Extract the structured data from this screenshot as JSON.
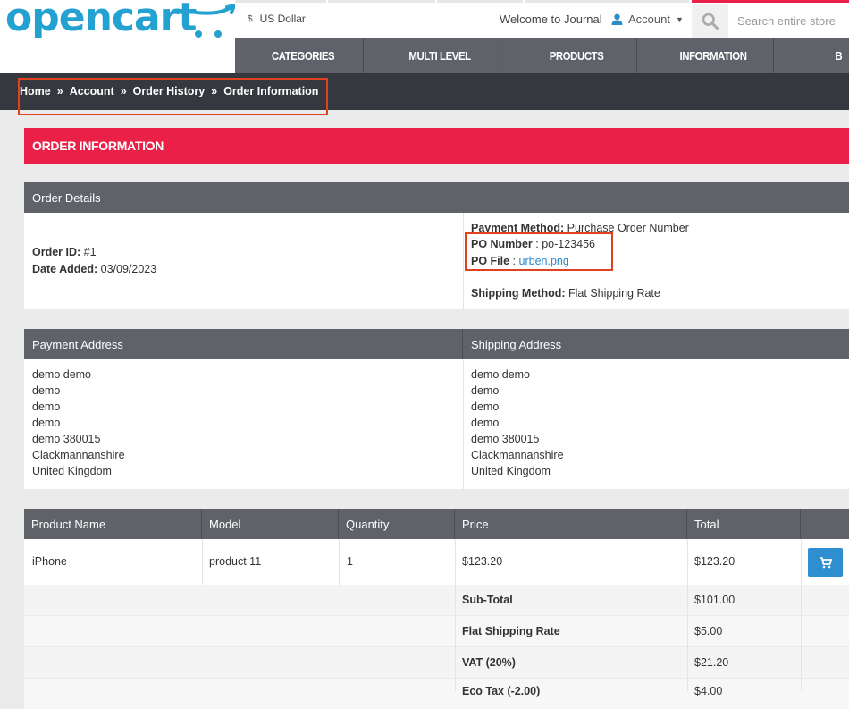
{
  "header": {
    "logo_text": "opencart",
    "currency": {
      "symbol": "$",
      "label": "US Dollar"
    },
    "welcome": "Welcome to Journal",
    "account_label": "Account",
    "search_placeholder": "Search entire store",
    "menu": [
      "CATEGORIES",
      "MULTI LEVEL",
      "PRODUCTS",
      "INFORMATION",
      "B"
    ]
  },
  "breadcrumb": [
    "Home",
    "Account",
    "Order History",
    "Order Information"
  ],
  "breadcrumb_separator": "»",
  "page_title": "ORDER INFORMATION",
  "order_details": {
    "heading": "Order Details",
    "order_id_label": "Order ID:",
    "order_id": "#1",
    "date_added_label": "Date Added:",
    "date_added": "03/09/2023",
    "payment_method_label": "Payment Method:",
    "payment_method": "Purchase Order Number",
    "po_number_label": "PO Number",
    "po_number": ": po-123456",
    "po_file_label": "PO File",
    "po_file_sep": " : ",
    "po_file": "urben.png",
    "shipping_method_label": "Shipping Method:",
    "shipping_method": "Flat Shipping Rate"
  },
  "addresses": {
    "payment_heading": "Payment Address",
    "shipping_heading": "Shipping Address",
    "payment_lines": [
      "demo demo",
      "demo",
      "demo",
      "demo",
      "demo 380015",
      "Clackmannanshire",
      "United Kingdom"
    ],
    "shipping_lines": [
      "demo demo",
      "demo",
      "demo",
      "demo",
      "demo 380015",
      "Clackmannanshire",
      "United Kingdom"
    ]
  },
  "products": {
    "columns": [
      "Product Name",
      "Model",
      "Quantity",
      "Price",
      "Total"
    ],
    "rows": [
      {
        "name": "iPhone",
        "model": "product 11",
        "quantity": "1",
        "price": "$123.20",
        "total": "$123.20"
      }
    ],
    "totals": [
      {
        "label": "Sub-Total",
        "value": "$101.00"
      },
      {
        "label": "Flat Shipping Rate",
        "value": "$5.00"
      },
      {
        "label": "VAT (20%)",
        "value": "$21.20"
      },
      {
        "label": "Eco Tax (-2.00)",
        "value": "$4.00"
      }
    ]
  },
  "colors": {
    "logo": "#23a1d1",
    "menu_bg": "#5f6369",
    "breadcrumb_bg": "#35393f",
    "title_bg": "#ea2048",
    "link": "#2a8cc8",
    "cart_button": "#2e8fd0",
    "highlight_box": "#e0411f"
  },
  "icons": {
    "account": "user-icon",
    "search": "search-icon",
    "cart": "cart-icon",
    "dropdown": "caret-down-icon"
  }
}
